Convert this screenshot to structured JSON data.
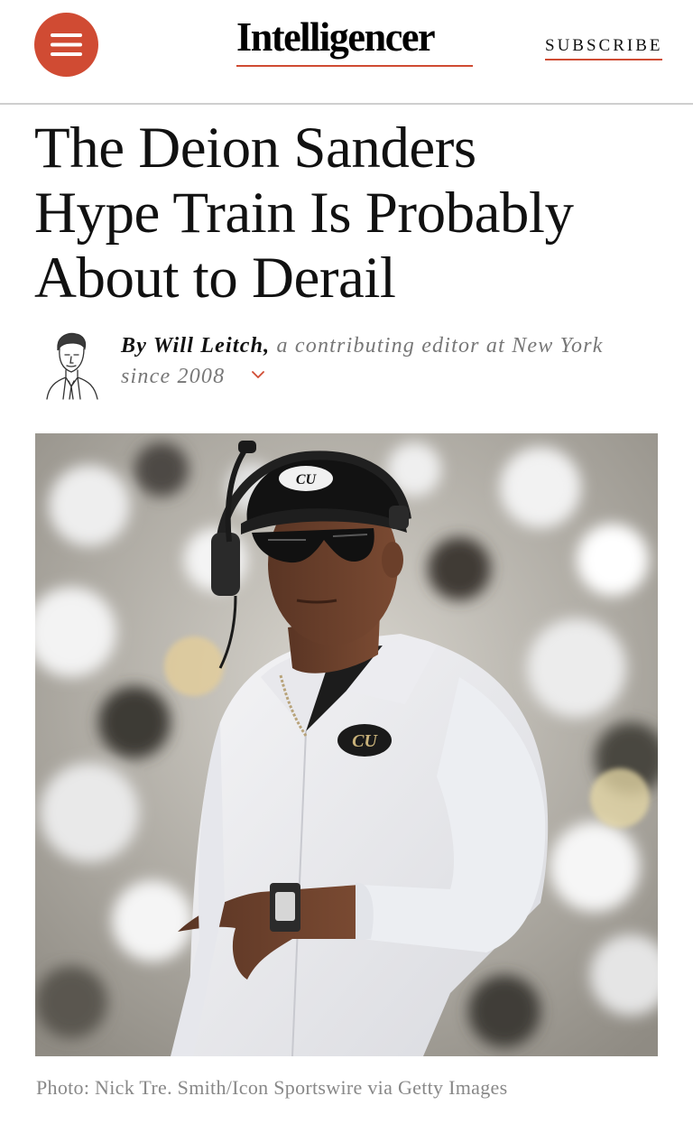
{
  "header": {
    "menu_icon": "hamburger-menu-icon",
    "logo_text": "Intelligencer",
    "subscribe_label": "SUBSCRIBE"
  },
  "article": {
    "headline_lines": [
      "The Deion Sanders",
      "Hype Train Is Probably",
      "About to Derail"
    ],
    "byline": {
      "prefix": "By Will Leitch,",
      "description": "a contributing editor at New York since 2008",
      "expand_icon": "chevron-down-icon"
    },
    "photo_caption": "Photo: Nick Tre. Smith/Icon Sportswire via Getty Images"
  },
  "colors": {
    "accent": "#d04b33",
    "text": "#111111",
    "muted": "#888888",
    "divider": "#cfcfcf"
  }
}
